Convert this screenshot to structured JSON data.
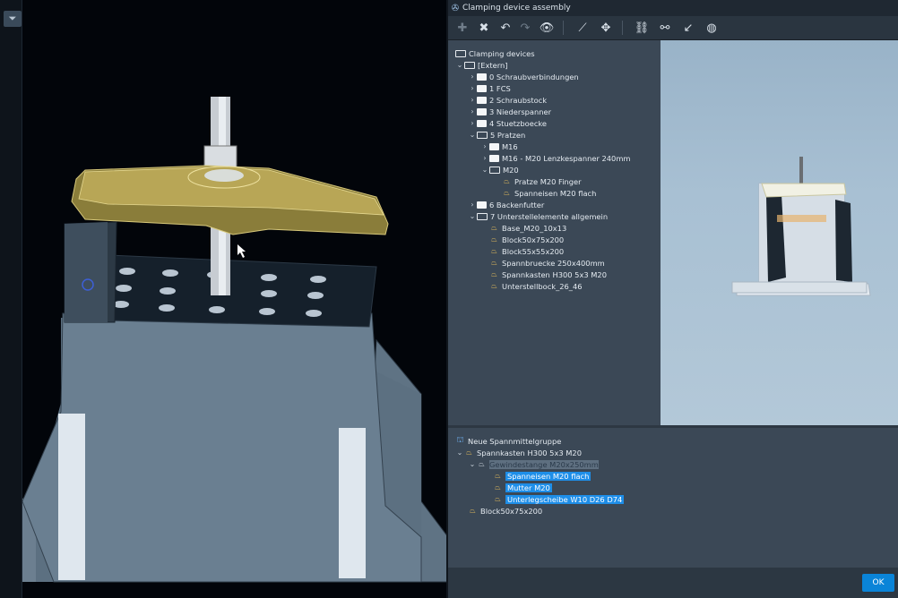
{
  "dialog": {
    "title": "Clamping device assembly",
    "ok_label": "OK"
  },
  "toolbar": {
    "icons": [
      "add-icon",
      "remove-icon",
      "rotate-left-icon",
      "rotate-right-icon",
      "eye-icon",
      "axis-icon",
      "move-icon",
      "link-icon",
      "unlink-icon",
      "pick-icon",
      "sphere-icon"
    ]
  },
  "tree": {
    "root": "Clamping devices",
    "extern": "[Extern]",
    "items": {
      "i0": "0 Schraubverbindungen",
      "i1": "1 FCS",
      "i2": "2 Schraubstock",
      "i3": "3 Niederspanner",
      "i4": "4 Stuetzboecke",
      "i5": "5 Pratzen",
      "i5a": "M16",
      "i5b": "M16 - M20 Lenzkespanner 240mm",
      "i5c": "M20",
      "i5c1": "Pratze M20 Finger",
      "i5c2": "Spanneisen M20 flach",
      "i6": "6 Backenfutter",
      "i7": "7 Unterstellelemente allgemein",
      "i7a": "Base_M20_10x13",
      "i7b": "Block50x75x200",
      "i7c": "Block55x55x200",
      "i7d": "Spannbruecke 250x400mm",
      "i7e": "Spannkasten H300 5x3 M20",
      "i7f": "Unterstellbock_26_46"
    }
  },
  "assembly": {
    "group": "Neue Spannmittelgruppe",
    "box": "Spannkasten H300 5x3 M20",
    "rod": "Gewindestange M20x250mm",
    "clamp": "Spanneisen M20 flach",
    "nut": "Mutter M20",
    "washer": "Unterlegscheibe W10 D26 D74",
    "block": "Block50x75x200"
  },
  "colors": {
    "accent": "#1e8ee8",
    "panel": "#3b4856",
    "part_icon": "#d9b55a"
  }
}
